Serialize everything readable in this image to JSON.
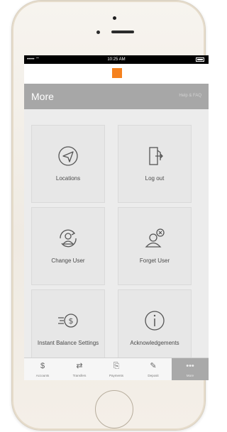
{
  "status_bar": {
    "signal": "••••• ⌔",
    "time": "10:25 AM"
  },
  "header": {
    "title": "More",
    "right_text": "Help & FAQ"
  },
  "tiles": [
    {
      "label": "Locations",
      "icon": "location-arrow-icon"
    },
    {
      "label": "Log out",
      "icon": "door-exit-icon"
    },
    {
      "label": "Change User",
      "icon": "change-user-icon"
    },
    {
      "label": "Forget User",
      "icon": "forget-user-icon"
    },
    {
      "label": "Instant Balance Settings",
      "icon": "instant-balance-icon"
    },
    {
      "label": "Acknowledgements",
      "icon": "info-icon"
    }
  ],
  "tabs": [
    {
      "label": "Accounts",
      "icon": "dollar-icon"
    },
    {
      "label": "Transfers",
      "icon": "transfer-icon"
    },
    {
      "label": "Payments",
      "icon": "payment-icon"
    },
    {
      "label": "Deposit",
      "icon": "deposit-icon"
    },
    {
      "label": "More",
      "icon": "more-icon",
      "active": true
    }
  ],
  "colors": {
    "brand_orange": "#f5821f",
    "header_gray": "#a7a7a7",
    "tile_bg": "#e7e7e7"
  }
}
